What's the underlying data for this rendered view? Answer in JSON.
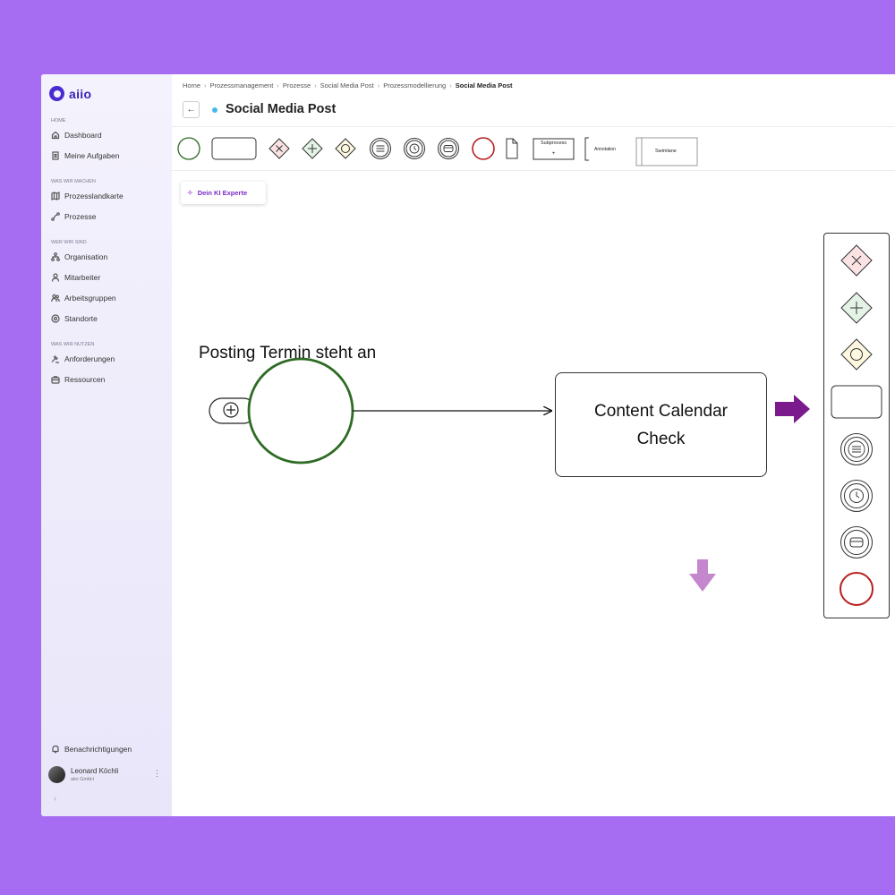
{
  "app": {
    "logo_text": "aiio"
  },
  "sidebar": {
    "sections": [
      {
        "label": "HOME",
        "items": [
          {
            "label": "Dashboard",
            "icon": "home-icon"
          },
          {
            "label": "Meine Aufgaben",
            "icon": "task-list-icon"
          }
        ]
      },
      {
        "label": "WAS WIR MACHEN",
        "items": [
          {
            "label": "Prozesslandkarte",
            "icon": "map-icon"
          },
          {
            "label": "Prozesse",
            "icon": "process-icon"
          }
        ]
      },
      {
        "label": "WER WIR SIND",
        "items": [
          {
            "label": "Organisation",
            "icon": "org-chart-icon"
          },
          {
            "label": "Mitarbeiter",
            "icon": "user-icon"
          },
          {
            "label": "Arbeitsgruppen",
            "icon": "users-icon"
          },
          {
            "label": "Standorte",
            "icon": "location-icon"
          }
        ]
      },
      {
        "label": "WAS WIR NUTZEN",
        "items": [
          {
            "label": "Anforderungen",
            "icon": "gavel-icon"
          },
          {
            "label": "Ressourcen",
            "icon": "briefcase-icon"
          }
        ]
      }
    ],
    "notifications_label": "Benachrichtigungen",
    "user": {
      "name": "Leonard Köchli",
      "org": "aiio GmbH"
    },
    "collapse_glyph": "‹"
  },
  "header": {
    "breadcrumb": [
      "Home",
      "Prozessmanagement",
      "Prozesse",
      "Social Media Post",
      "Prozessmodellierung",
      "Social Media Post"
    ],
    "back_glyph": "←",
    "title": "Social Media Post"
  },
  "palette": {
    "subprocess_label": "Subprocess",
    "subprocess_marker": "+",
    "annotation_label": "Annotation",
    "swimlane_label": "Swimlane",
    "items": [
      "start-event",
      "task",
      "exclusive-gateway",
      "parallel-gateway",
      "inclusive-gateway",
      "conditional-event",
      "timer-event",
      "message-event",
      "end-event",
      "data-object",
      "subprocess",
      "annotation",
      "swimlane"
    ]
  },
  "ki_button": {
    "label": "Dein KI Experte"
  },
  "canvas": {
    "start_event_label": "Posting Termin steht an",
    "task_label": "Content Calendar Check"
  },
  "context_panel": {
    "items": [
      "exclusive-gateway",
      "parallel-gateway",
      "inclusive-gateway",
      "task",
      "conditional-event",
      "timer-event",
      "message-event",
      "end-event"
    ]
  },
  "colors": {
    "background": "#a66cf2",
    "brand": "#4a2bd1",
    "start_event": "#2e6b24",
    "end_event": "#b82020",
    "arrow_dark": "#7a1a8c",
    "arrow_light": "#c486cc"
  }
}
